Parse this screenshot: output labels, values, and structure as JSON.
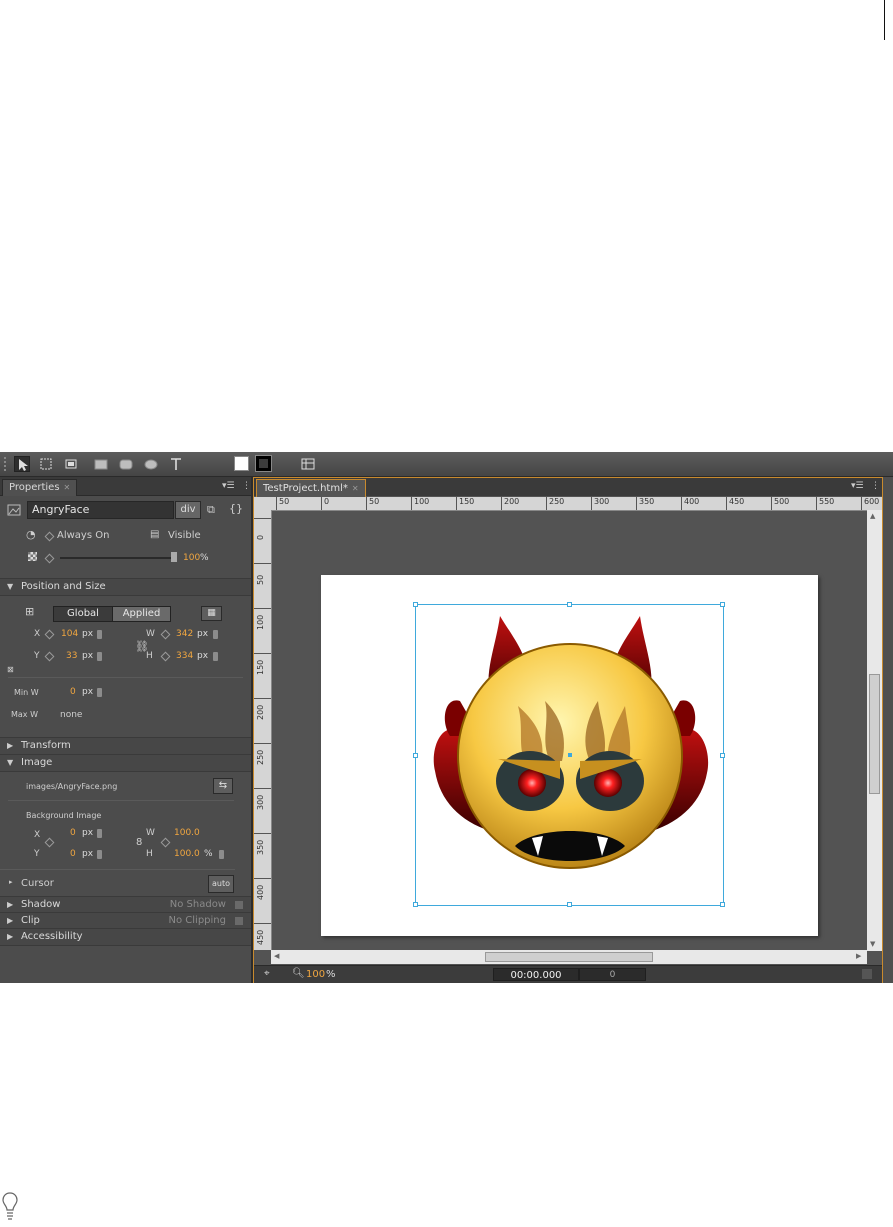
{
  "toolbar": {
    "tools": [
      "selection-tool",
      "transform-tool",
      "clipping-tool",
      "rectangle-tool",
      "rounded-rectangle-tool",
      "ellipse-tool",
      "text-tool"
    ]
  },
  "colors": {
    "fill": "#ffffff",
    "stroke": "#000000",
    "accent": "#f0a640",
    "selection": "#3fa9dc"
  },
  "properties": {
    "tab_label": "Properties",
    "element_name": "AngryFace",
    "element_type": "div",
    "always_on": "Always On",
    "visible": "Visible",
    "opacity": "100",
    "opacity_unit": "%",
    "opacity_level": 1.0,
    "position_size": {
      "title": "Position and Size",
      "global": "Global",
      "applied": "Applied",
      "x_label": "X",
      "x": "104",
      "x_unit": "px",
      "y_label": "Y",
      "y": "33",
      "y_unit": "px",
      "w_label": "W",
      "w": "342",
      "w_unit": "px",
      "h_label": "H",
      "h": "334",
      "h_unit": "px",
      "min_w_label": "Min W",
      "min_w": "0",
      "min_w_unit": "px",
      "max_w_label": "Max W",
      "max_w": "none"
    },
    "transform_title": "Transform",
    "image": {
      "title": "Image",
      "path": "images/AngryFace.png",
      "bg_title": "Background Image",
      "x_label": "X",
      "x": "0",
      "x_unit": "px",
      "y_label": "Y",
      "y": "0",
      "y_unit": "px",
      "w_label": "W",
      "w": "100.0",
      "h_label": "H",
      "h": "100.0",
      "h_unit": "%"
    },
    "cursor_label": "Cursor",
    "cursor_value": "auto",
    "shadow_label": "Shadow",
    "shadow_value": "No Shadow",
    "clip_label": "Clip",
    "clip_value": "No Clipping",
    "accessibility_label": "Accessibility"
  },
  "document": {
    "tab_label": "TestProject.html*",
    "ruler_h": [
      "50",
      "0",
      "50",
      "100",
      "150",
      "200",
      "250",
      "300",
      "350",
      "400",
      "450",
      "500",
      "550",
      "600"
    ],
    "ruler_v": [
      "0",
      "50",
      "100",
      "150",
      "200",
      "250",
      "300",
      "350",
      "400",
      "450"
    ],
    "zoom": "100",
    "zoom_unit": "%",
    "time": "00:00.000",
    "frame": "0"
  }
}
